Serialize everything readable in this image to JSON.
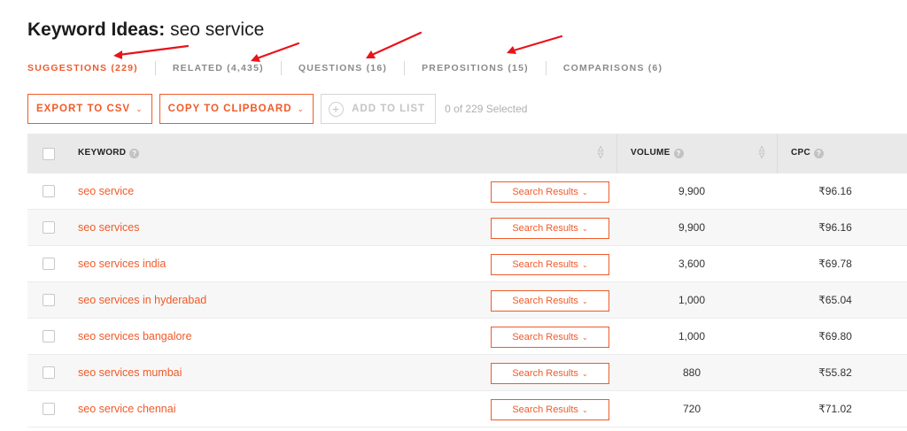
{
  "page": {
    "title_label": "Keyword Ideas:",
    "title_query": "seo service"
  },
  "tabs": [
    {
      "label": "SUGGESTIONS (229)",
      "active": true
    },
    {
      "label": "RELATED (4,435)",
      "active": false
    },
    {
      "label": "QUESTIONS (16)",
      "active": false
    },
    {
      "label": "PREPOSITIONS (15)",
      "active": false
    },
    {
      "label": "COMPARISONS (6)",
      "active": false
    }
  ],
  "toolbar": {
    "export_label": "EXPORT TO CSV",
    "copy_label": "COPY TO CLIPBOARD",
    "add_label": "ADD TO LIST",
    "selected_text": "0 of 229 Selected"
  },
  "table": {
    "headers": {
      "keyword": "KEYWORD",
      "volume": "VOLUME",
      "cpc": "CPC"
    },
    "search_results_label": "Search Results",
    "rows": [
      {
        "keyword": "seo service",
        "volume": "9,900",
        "cpc": "₹96.16"
      },
      {
        "keyword": "seo services",
        "volume": "9,900",
        "cpc": "₹96.16"
      },
      {
        "keyword": "seo services india",
        "volume": "3,600",
        "cpc": "₹69.78"
      },
      {
        "keyword": "seo services in hyderabad",
        "volume": "1,000",
        "cpc": "₹65.04"
      },
      {
        "keyword": "seo services bangalore",
        "volume": "1,000",
        "cpc": "₹69.80"
      },
      {
        "keyword": "seo services mumbai",
        "volume": "880",
        "cpc": "₹55.82"
      },
      {
        "keyword": "seo service chennai",
        "volume": "720",
        "cpc": "₹71.02"
      }
    ]
  },
  "colors": {
    "accent": "#f05a28",
    "annotation_arrow": "#e8131b",
    "header_bg": "#e9e9e9"
  }
}
